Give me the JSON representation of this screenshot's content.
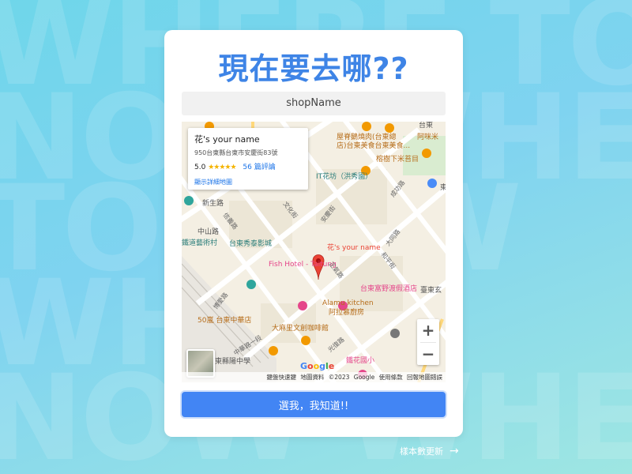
{
  "background": {
    "words": [
      "WHERE TO",
      "NOW WHE",
      "TO NOW",
      "WHERE",
      "NOW WHE"
    ]
  },
  "card": {
    "title": "現在要去哪??",
    "shop_name": "shopName",
    "confirm_label": "選我，我知道!!"
  },
  "map": {
    "info_window": {
      "name": "花's your name",
      "address": "950台東縣台東市安慶街83號",
      "rating": "5.0",
      "stars": "★★★★★",
      "reviews": "56 篇評論",
      "link": "顯示詳細地圖"
    },
    "marker_label": "花's your name",
    "labels": [
      "屋脊鵝燒肉(台東總",
      "店)台東美食台東美食...",
      "阿咪米",
      "榕樹下米苔目",
      "台東",
      "IT花坊（洪秀園）",
      "成功路",
      "東",
      "信義路",
      "文化街",
      "安慶街",
      "新生路",
      "中山路",
      "台東秀泰影城",
      "大同路",
      "鐵道藝術村",
      "和平街",
      "正氣路",
      "Fish Hotel - Taitung",
      "台東富野渡假酒店",
      "Alamu kitchen",
      "阿拉慕廚房",
      "臺東玄",
      "50嵐 台東中華店",
      "大麻里文創咖啡館",
      "博愛路",
      "中華路一段",
      "光復路",
      "鐵花國小",
      "東縣陽中學"
    ],
    "footer": {
      "shortcuts": "鍵盤快速鍵",
      "data": "地圖資料 ©2023 Google",
      "terms": "使用條款",
      "report": "回報地圖錯誤"
    },
    "logo": "Google",
    "zoom_in": "+",
    "zoom_out": "−"
  },
  "next_link": {
    "label": "樣本數更新",
    "arrow": "→"
  },
  "colors": {
    "accent": "#3e84e6",
    "button": "#4285f4",
    "marker": "#ea4335"
  }
}
